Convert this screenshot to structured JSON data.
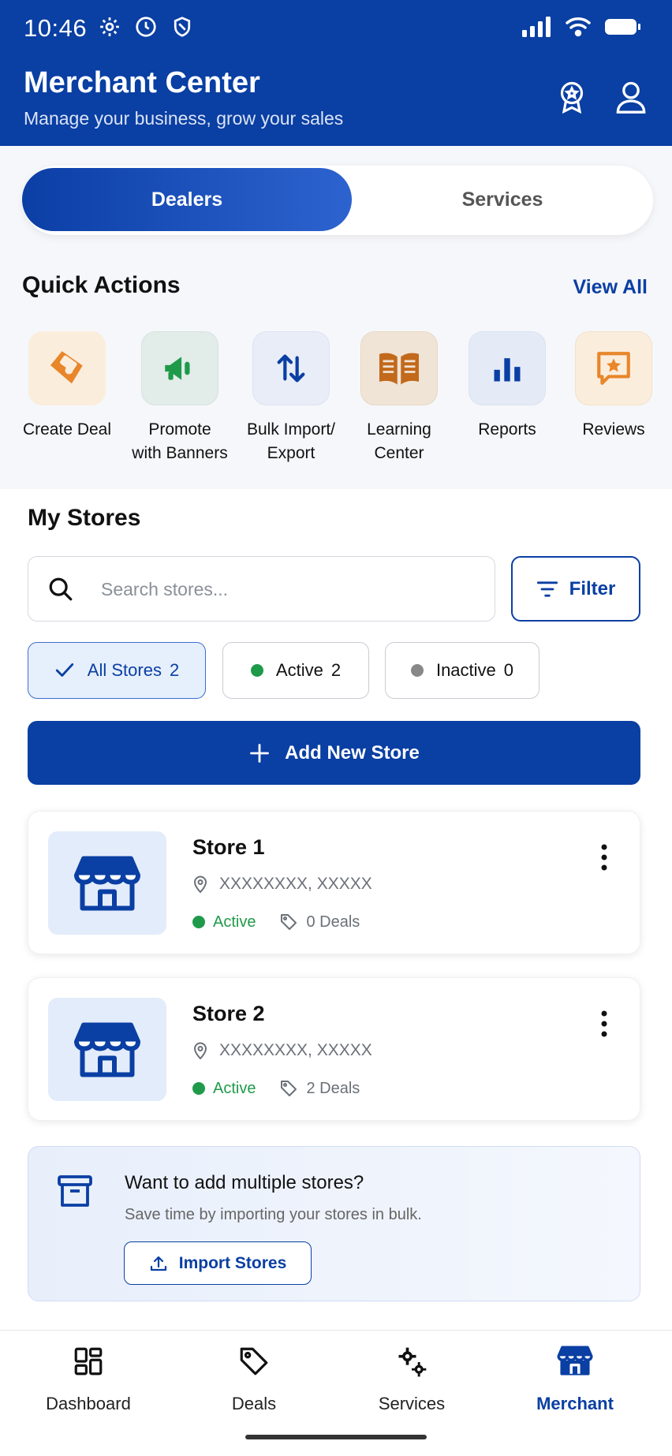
{
  "status": {
    "time": "10:46"
  },
  "header": {
    "title": "Merchant Center",
    "subtitle": "Manage your business, grow your sales"
  },
  "segments": {
    "active": "Dealers",
    "inactive": "Services"
  },
  "quick_actions": {
    "title": "Quick Actions",
    "view_all": "View All",
    "items": [
      {
        "line1": "Create Deal",
        "line2": "",
        "icon": "tag-icon",
        "color": "#e8862a"
      },
      {
        "line1": "Promote",
        "line2": "with Banners",
        "icon": "megaphone-icon",
        "color": "#1f9a4a"
      },
      {
        "line1": "Bulk Import/",
        "line2": "Export",
        "icon": "arrows-updown-icon",
        "color": "#0a3fa3"
      },
      {
        "line1": "Learning",
        "line2": "Center",
        "icon": "book-icon",
        "color": "#c2691b"
      },
      {
        "line1": "Reports",
        "line2": "",
        "icon": "bar-chart-icon",
        "color": "#0a3fa3"
      },
      {
        "line1": "Reviews",
        "line2": "",
        "icon": "star-message-icon",
        "color": "#e8862a"
      }
    ]
  },
  "stores": {
    "title": "My Stores",
    "search_placeholder": "Search stores...",
    "filter_label": "Filter",
    "chips": [
      {
        "label": "All Stores",
        "count": "2"
      },
      {
        "label": "Active",
        "count": "2"
      },
      {
        "label": "Inactive",
        "count": "0"
      }
    ],
    "add_label": "Add New Store",
    "list": [
      {
        "name": "Store 1",
        "address": "XXXXXXXX, XXXXX",
        "status": "Active",
        "deals": "0 Deals"
      },
      {
        "name": "Store 2",
        "address": "XXXXXXXX, XXXXX",
        "status": "Active",
        "deals": "2 Deals"
      }
    ]
  },
  "bulk": {
    "title": "Want to add multiple stores?",
    "subtitle": "Save time by importing your stores in bulk.",
    "button": "Import Stores"
  },
  "nav": {
    "items": [
      {
        "label": "Dashboard"
      },
      {
        "label": "Deals"
      },
      {
        "label": "Services"
      },
      {
        "label": "Merchant"
      }
    ]
  },
  "colors": {
    "brand": "#0a3fa3",
    "active_green": "#1f9a4a",
    "inactive_gray": "#888888"
  }
}
